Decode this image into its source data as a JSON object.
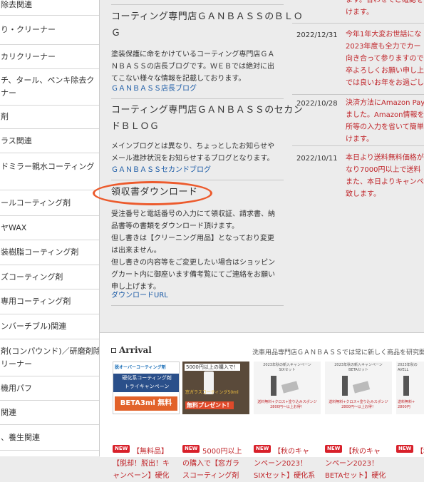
{
  "sidebar": [
    {
      "label": "除去関連"
    },
    {
      "label": "り・クリーナー"
    },
    {
      "label": "カリクリーナー"
    },
    {
      "label": "チ、タール、ペンキ除去ク\nナー"
    },
    {
      "label": "剤"
    },
    {
      "label": "ラス関連"
    },
    {
      "label": "ドミラー親水コーティング"
    },
    {
      "label": "ールコーティング剤"
    },
    {
      "label": "ヤWAX"
    },
    {
      "label": "装樹脂コーティング剤"
    },
    {
      "label": "ズコーティング剤"
    },
    {
      "label": "専用コーティング剤"
    },
    {
      "label": "ンバーチブル)関連"
    },
    {
      "label": "剤(コンパウンド)／研磨剤除\nリーナー"
    },
    {
      "label": "機用パフ"
    },
    {
      "label": "関連"
    },
    {
      "label": "、養生関連"
    }
  ],
  "blogs": [
    {
      "title": "コーティング専門店ＧＡＮＢＡＳＳのＢＬＯ\nＧ",
      "desc": "塗装保護に命をかけているコーティング専門店ＧＡ\nＮＢＡＳＳの店長ブログです。ＷＥＢでは絶対に出\nてこない様々な情報を記載しております。",
      "link": "ＧＡＮＢＡＳＳ店長ブログ"
    },
    {
      "title": "コーティング専門店ＧＡＮＢＡＳＳのセカン\nドＢＬＯＧ",
      "desc": "メインブログとは異なり、ちょっとしたお知らせや\nメール進捗状況をお知らせするブログとなります。",
      "link": "ＧＡＮＢＡＳＳセカンドブログ"
    },
    {
      "title": "領収書ダウンロード",
      "desc": "受注番号と電話番号の入力にて領収証、請求書、納\n品書等の書類をダウンロード頂けます。\n但し書きは【クリーニング用品】となっており変更\nは出来ません。\n但し書きの内容等をご変更したい場合はショッピン\nグカート内に御座います備考覧にてご連絡をお願い\n申し上げます。",
      "link": "ダウンロードURL"
    }
  ],
  "news": [
    {
      "date": "",
      "text": "ます。合わせてご確認を\nけます。"
    },
    {
      "date": "2022/12/31",
      "text": "今年1年大変お世話にな\n2023年度も全力でカー\n向き合って参りますので\n卒よろしくお願い申し上\nでは良いお年をお過ごし"
    },
    {
      "date": "2022/10/28",
      "text": "決済方法にAmazon Pay\nました。Amazon情報を\n所等の入力を省いて簡単\nけます。"
    },
    {
      "date": "2022/10/11",
      "text": "本日より送料無料価格が\nなり7000円以上で送料\nまた、本日よりキャンペ\n致します。"
    }
  ],
  "arrival": {
    "title": "Arrival",
    "subtitle": "洗車用品専門店ＧＡＮＢＡＳＳでは常に新しく商品を研究開",
    "badge": "NEW",
    "products": [
      {
        "name": "【無料品】\n【脱却！脱出！キ\nャンペーン】硬化",
        "thumb_top": "脱オーバーコーティング剤",
        "thumb_mid": "硬化系コーティング剤\nトライキャンペーン",
        "thumb_bot": "BETA3ml 無料"
      },
      {
        "name": "5000円以上\nの購入で【窓ガラ\nスコーティング剤",
        "thumb_top": "5000円以上の購入で！",
        "thumb_mid": "窓ガラスコーティング50ml",
        "thumb_bot": "無料プレゼント！"
      },
      {
        "name": "【秋のキャ\nンペーン2023！\nSIXセット】硬化系",
        "thumb_top": "2023年秋の新入キャンペーン\nSIXセット",
        "thumb_mid": "",
        "thumb_bot": "送料無料+クロス+塗り込みスポンジ\n2800円〜以上お得！"
      },
      {
        "name": "【秋のキャ\nンペーン2023！\nBETAセット】硬化",
        "thumb_top": "2023年秋の新入キャンペーン\nBETAセット",
        "thumb_mid": "",
        "thumb_bot": "送料無料+クロス+塗り込みスポンジ\n2800円〜以上お得！"
      },
      {
        "name": "【秋\nンペーン\nAVELLセ",
        "thumb_top": "2023年秋の\nAVELL",
        "thumb_mid": "",
        "thumb_bot": "送料無料+\n2800円"
      }
    ]
  },
  "colors": {
    "accent_red": "#c0262b",
    "link_blue": "#1a5aa6",
    "highlight_oval": "#ec5a2c"
  }
}
